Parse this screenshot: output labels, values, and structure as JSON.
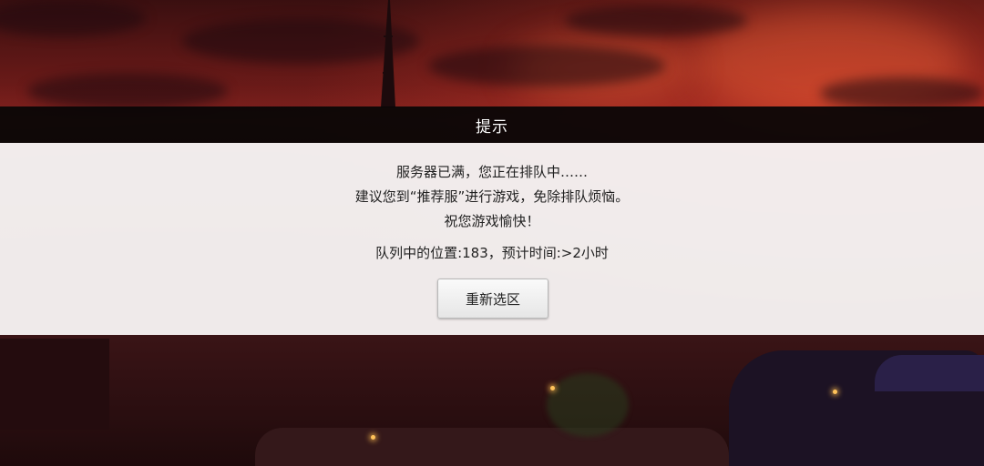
{
  "dialog": {
    "title": "提示",
    "lines": [
      "服务器已满，您正在排队中……",
      "建议您到“推荐服”进行游戏，免除排队烦恼。",
      "祝您游戏愉快！"
    ],
    "queue_info": "队列中的位置:183，预计时间:>2小时",
    "button_label": "重新选区"
  },
  "colors": {
    "header_bg": "#080606",
    "body_bg": "#f6f4f4",
    "text": "#222222",
    "sky_accent": "#8a2420"
  }
}
